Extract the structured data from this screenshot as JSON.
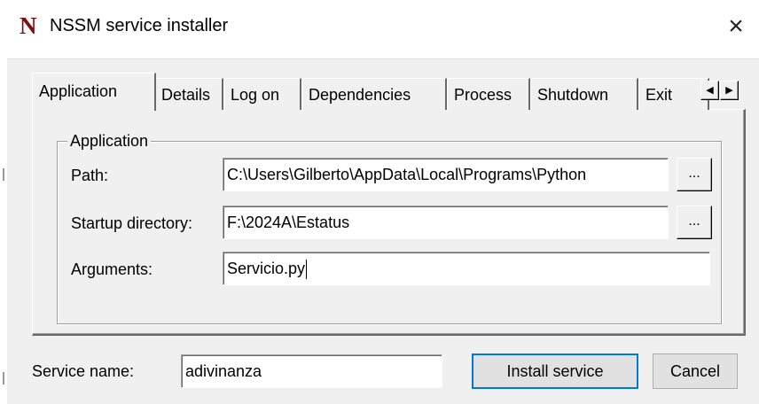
{
  "window": {
    "logo": "N",
    "title": "NSSM service installer",
    "close": "×"
  },
  "tabs": [
    {
      "label": "Application",
      "active": true
    },
    {
      "label": "Details",
      "active": false
    },
    {
      "label": "Log on",
      "active": false
    },
    {
      "label": "Dependencies",
      "active": false
    },
    {
      "label": "Process",
      "active": false
    },
    {
      "label": "Shutdown",
      "active": false
    },
    {
      "label": "Exit",
      "active": false
    }
  ],
  "tab_scroll": {
    "left": "◀",
    "right": "▶"
  },
  "application_group": {
    "label": "Application",
    "path": {
      "label": "Path:",
      "value": "C:\\Users\\Gilberto\\AppData\\Local\\Programs\\Python",
      "browse": "..."
    },
    "startup": {
      "label": "Startup directory:",
      "value": "F:\\2024A\\Estatus",
      "browse": "..."
    },
    "arguments": {
      "label": "Arguments:",
      "value": "Servicio.py"
    }
  },
  "service": {
    "label": "Service name:",
    "value": "adivinanza"
  },
  "buttons": {
    "install": "Install service",
    "cancel": "Cancel"
  }
}
